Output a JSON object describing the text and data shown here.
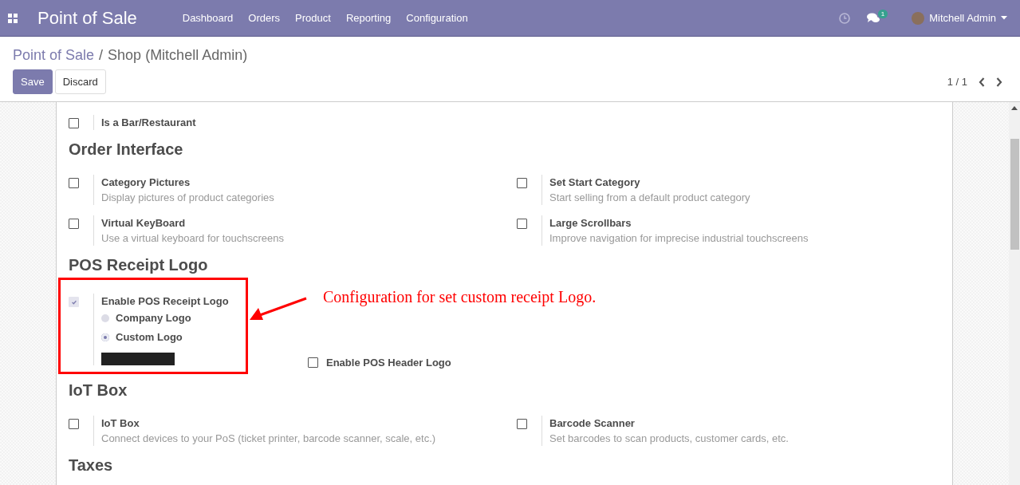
{
  "navbar": {
    "app_title": "Point of Sale",
    "menu": [
      "Dashboard",
      "Orders",
      "Product",
      "Reporting",
      "Configuration"
    ],
    "messages_count": "1",
    "user": "Mitchell Admin"
  },
  "breadcrumb": {
    "parent": "Point of Sale",
    "separator": "/",
    "current": "Shop (Mitchell Admin)"
  },
  "buttons": [
    {
      "label": "Save",
      "kind": "primary"
    },
    {
      "label": "Discard",
      "kind": "secondary"
    }
  ],
  "pager": "1 / 1",
  "blocks": [
    {
      "kind": "settings",
      "settings": [
        {
          "label": "Is a Bar/Restaurant",
          "checked": false
        }
      ]
    },
    {
      "kind": "heading",
      "text": "Order Interface"
    },
    {
      "kind": "settings",
      "settings": [
        {
          "label": "Category Pictures",
          "description": "Display pictures of product categories",
          "checked": false
        },
        {
          "label": "Set Start Category",
          "description": "Start selling from a default product category",
          "checked": false
        }
      ]
    },
    {
      "kind": "settings",
      "settings": [
        {
          "label": "Virtual KeyBoard",
          "description": "Use a virtual keyboard for touchscreens",
          "checked": false
        },
        {
          "label": "Large Scrollbars",
          "description": "Improve navigation for imprecise industrial touchscreens",
          "checked": false
        }
      ]
    },
    {
      "kind": "heading",
      "text": "POS Receipt Logo"
    },
    {
      "kind": "receipt_logo",
      "enable": {
        "label": "Enable POS Receipt Logo",
        "checked": true,
        "disabled": true
      },
      "options": [
        {
          "label": "Company Logo",
          "selected": false
        },
        {
          "label": "Custom Logo",
          "selected": true
        }
      ],
      "header_logo": {
        "label": "Enable POS Header Logo",
        "checked": false
      },
      "annotation": "Configuration for set custom receipt Logo."
    },
    {
      "kind": "heading",
      "text": "IoT Box"
    },
    {
      "kind": "settings",
      "settings": [
        {
          "label": "IoT Box",
          "description": "Connect devices to your PoS (ticket printer, barcode scanner, scale, etc.)",
          "checked": false
        },
        {
          "label": "Barcode Scanner",
          "description": "Set barcodes to scan products, customer cards, etc.",
          "checked": false
        }
      ]
    },
    {
      "kind": "heading",
      "text": "Taxes"
    }
  ]
}
